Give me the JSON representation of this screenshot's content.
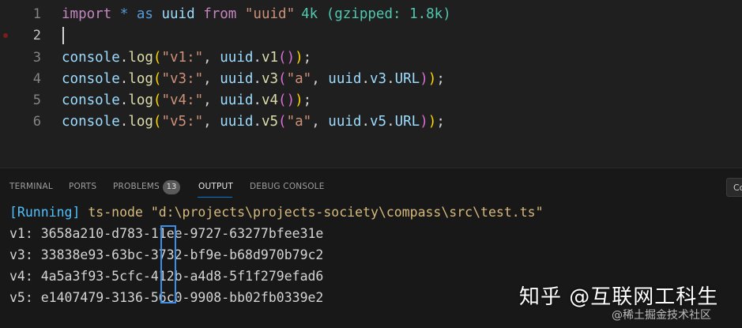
{
  "editor": {
    "lines": [
      {
        "num": "1"
      },
      {
        "num": "2"
      },
      {
        "num": "3"
      },
      {
        "num": "4"
      },
      {
        "num": "5"
      },
      {
        "num": "6"
      }
    ],
    "l1": {
      "import": "import",
      "star": "*",
      "as": "as",
      "name": "uuid",
      "from": "from",
      "module": "\"uuid\"",
      "size_hint": "4k (gzipped: 1.8k)"
    },
    "t": {
      "console": "console",
      "dot": ".",
      "log": "log",
      "open": "(",
      "close": ")",
      "semi": ";",
      "comma": ",",
      "uuid": "uuid",
      "a": "\"a\"",
      "s1": "\"v1:\"",
      "s3": "\"v3:\"",
      "s4": "\"v4:\"",
      "s5": "\"v5:\"",
      "v1": "v1",
      "v3": "v3",
      "v4": "v4",
      "v5": "v5",
      "url": "URL"
    }
  },
  "panel": {
    "tabs": [
      {
        "label": "TERMINAL"
      },
      {
        "label": "PORTS"
      },
      {
        "label": "PROBLEMS"
      },
      {
        "label": "OUTPUT"
      },
      {
        "label": "DEBUG CONSOLE"
      }
    ],
    "problems_count": "13",
    "side_button": "Co",
    "output": {
      "running_tag": "[Running]",
      "command": "ts-node \"d:\\projects\\projects-society\\compass\\src\\test.ts\"",
      "rows": [
        {
          "label": "v1:",
          "value": "3658a210-d783-11ee-9727-63277bfee31e"
        },
        {
          "label": "v3:",
          "value": "33838e93-63bc-3732-bf9e-b68d970b79c2"
        },
        {
          "label": "v4:",
          "value": "4a5a3f93-5cfc-412b-a4d8-5f1f279efad6"
        },
        {
          "label": "v5:",
          "value": "e1407479-3136-56c0-9908-bb02fb0339e2"
        }
      ]
    }
  },
  "watermark": {
    "main": "知乎 @互联网工科生",
    "sub": "@稀土掘金技术社区"
  }
}
